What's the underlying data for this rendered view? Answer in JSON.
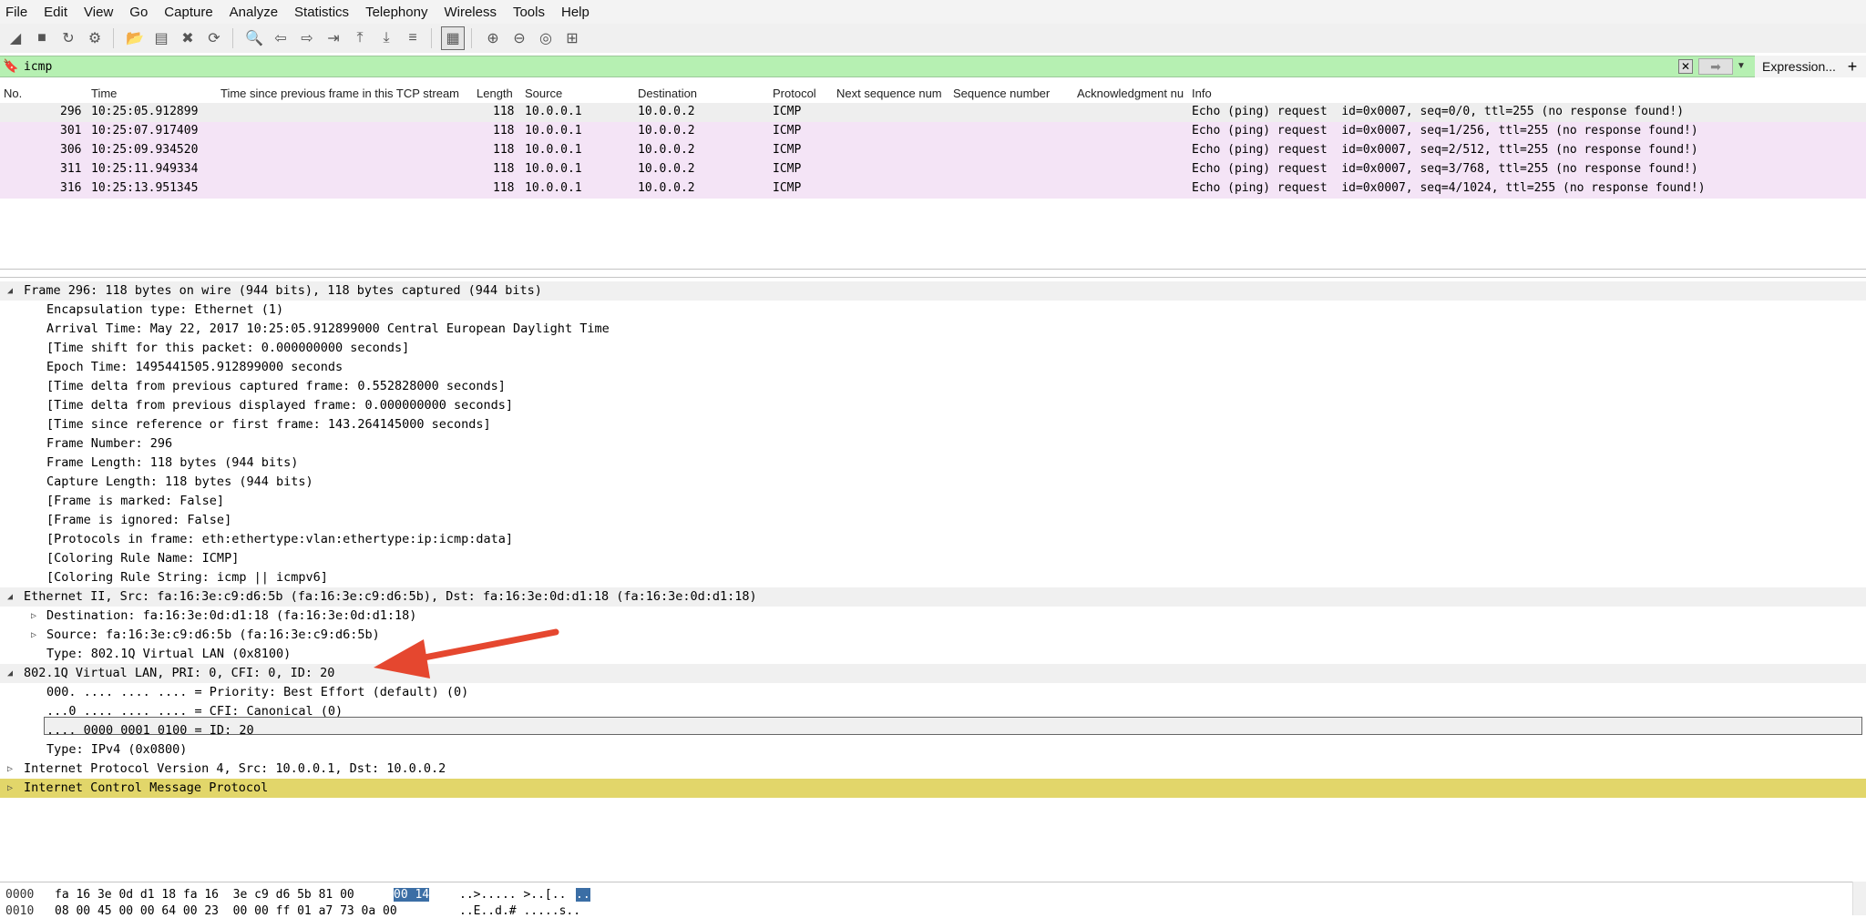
{
  "menu": [
    "File",
    "Edit",
    "View",
    "Go",
    "Capture",
    "Analyze",
    "Statistics",
    "Telephony",
    "Wireless",
    "Tools",
    "Help"
  ],
  "toolbar_icons": [
    "start-capture-icon",
    "stop-capture-icon",
    "restart-capture-icon",
    "capture-options-icon",
    "open-file-icon",
    "save-file-icon",
    "close-file-icon",
    "reload-file-icon",
    "find-packet-icon",
    "go-back-icon",
    "go-forward-icon",
    "go-to-packet-icon",
    "go-first-icon",
    "go-last-icon",
    "auto-scroll-icon",
    "colorize-icon",
    "zoom-in-icon",
    "zoom-out-icon",
    "normal-size-icon",
    "resize-columns-icon"
  ],
  "filter": {
    "value": "icmp",
    "expression_label": "Expression...",
    "plus_label": "+"
  },
  "columns": [
    "No.",
    "Time",
    "Time since previous frame in this TCP stream",
    "Length",
    "Source",
    "Destination",
    "Protocol",
    "Next sequence num",
    "Sequence number",
    "Acknowledgment nu",
    "Info"
  ],
  "packets": [
    {
      "no": "296",
      "time": "10:25:05.912899",
      "length": "118",
      "source": "10.0.0.1",
      "destination": "10.0.0.2",
      "protocol": "ICMP",
      "info": "Echo (ping) request  id=0x0007, seq=0/0, ttl=255 (no response found!)"
    },
    {
      "no": "301",
      "time": "10:25:07.917409",
      "length": "118",
      "source": "10.0.0.1",
      "destination": "10.0.0.2",
      "protocol": "ICMP",
      "info": "Echo (ping) request  id=0x0007, seq=1/256, ttl=255 (no response found!)"
    },
    {
      "no": "306",
      "time": "10:25:09.934520",
      "length": "118",
      "source": "10.0.0.1",
      "destination": "10.0.0.2",
      "protocol": "ICMP",
      "info": "Echo (ping) request  id=0x0007, seq=2/512, ttl=255 (no response found!)"
    },
    {
      "no": "311",
      "time": "10:25:11.949334",
      "length": "118",
      "source": "10.0.0.1",
      "destination": "10.0.0.2",
      "protocol": "ICMP",
      "info": "Echo (ping) request  id=0x0007, seq=3/768, ttl=255 (no response found!)"
    },
    {
      "no": "316",
      "time": "10:25:13.951345",
      "length": "118",
      "source": "10.0.0.1",
      "destination": "10.0.0.2",
      "protocol": "ICMP",
      "info": "Echo (ping) request  id=0x0007, seq=4/1024, ttl=255 (no response found!)"
    }
  ],
  "details": [
    {
      "text": "Frame 296: 118 bytes on wire (944 bits), 118 bytes captured (944 bits)",
      "tri": "◢"
    },
    {
      "text": "Encapsulation type: Ethernet (1)"
    },
    {
      "text": "Arrival Time: May 22, 2017 10:25:05.912899000 Central European Daylight Time"
    },
    {
      "text": "[Time shift for this packet: 0.000000000 seconds]"
    },
    {
      "text": "Epoch Time: 1495441505.912899000 seconds"
    },
    {
      "text": "[Time delta from previous captured frame: 0.552828000 seconds]"
    },
    {
      "text": "[Time delta from previous displayed frame: 0.000000000 seconds]"
    },
    {
      "text": "[Time since reference or first frame: 143.264145000 seconds]"
    },
    {
      "text": "Frame Number: 296"
    },
    {
      "text": "Frame Length: 118 bytes (944 bits)"
    },
    {
      "text": "Capture Length: 118 bytes (944 bits)"
    },
    {
      "text": "[Frame is marked: False]"
    },
    {
      "text": "[Frame is ignored: False]"
    },
    {
      "text": "[Protocols in frame: eth:ethertype:vlan:ethertype:ip:icmp:data]"
    },
    {
      "text": "[Coloring Rule Name: ICMP]"
    },
    {
      "text": "[Coloring Rule String: icmp || icmpv6]"
    },
    {
      "text": "Ethernet II, Src: fa:16:3e:c9:d6:5b (fa:16:3e:c9:d6:5b), Dst: fa:16:3e:0d:d1:18 (fa:16:3e:0d:d1:18)",
      "tri": "◢"
    },
    {
      "text": "Destination: fa:16:3e:0d:d1:18 (fa:16:3e:0d:d1:18)",
      "tri": "▷"
    },
    {
      "text": "Source: fa:16:3e:c9:d6:5b (fa:16:3e:c9:d6:5b)",
      "tri": "▷"
    },
    {
      "text": "Type: 802.1Q Virtual LAN (0x8100)"
    },
    {
      "text": "802.1Q Virtual LAN, PRI: 0, CFI: 0, ID: 20",
      "tri": "◢"
    },
    {
      "text": "000. .... .... .... = Priority: Best Effort (default) (0)"
    },
    {
      "text": "...0 .... .... .... = CFI: Canonical (0)"
    },
    {
      "text": ".... 0000 0001 0100 = ID: 20"
    },
    {
      "text": "Type: IPv4 (0x0800)"
    },
    {
      "text": "Internet Protocol Version 4, Src: 10.0.0.1, Dst: 10.0.0.2",
      "tri": "▷"
    },
    {
      "text": "Internet Control Message Protocol",
      "tri": "▷"
    }
  ],
  "hex": {
    "row0_offset": "0000",
    "row0_bytes_a": "fa 16 3e 0d d1 18 fa 16  3e c9 d6 5b 81 00",
    "row0_bytes_hl": "00 14",
    "row0_ascii_a": "..>..... >..[..",
    "row0_ascii_hl": "..",
    "row1_offset": "0010",
    "row1_bytes": "08 00 45 00 00 64 00 23  00 00 ff 01 a7 73 0a 00",
    "row1_ascii": "..E..d.# .....s.."
  },
  "colors": {
    "filter_bg": "#b6f0b2",
    "icmp_row": "#f4e4f6",
    "highlight_yellow": "#e2d66a",
    "annotation_arrow": "#e5472f"
  }
}
